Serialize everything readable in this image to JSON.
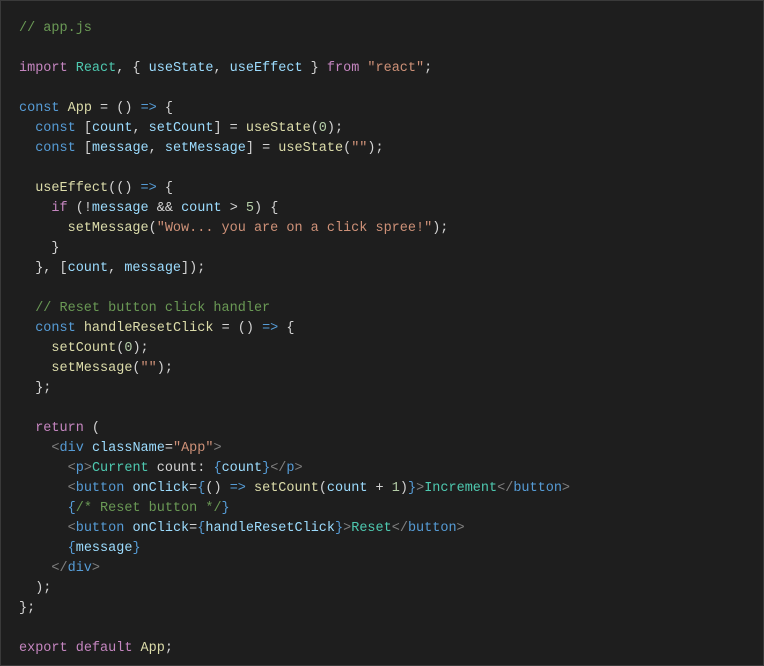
{
  "lines": {
    "l1_comment": "// app.js",
    "l2_import": "import",
    "l2_react": "React",
    "l2_usestate": "useState",
    "l2_useeffect": "useEffect",
    "l2_from": "from",
    "l2_reactstr": "\"react\"",
    "l3_const": "const",
    "l3_app": "App",
    "l4_const": "const",
    "l4_count": "count",
    "l4_setcount": "setCount",
    "l4_usestate": "useState",
    "l4_zero": "0",
    "l5_const": "const",
    "l5_message": "message",
    "l5_setmessage": "setMessage",
    "l5_usestate": "useState",
    "l5_empty": "\"\"",
    "l6_useeffect": "useEffect",
    "l7_if": "if",
    "l7_message": "message",
    "l7_count": "count",
    "l7_five": "5",
    "l8_setmessage": "setMessage",
    "l8_str": "\"Wow... you are on a click spree!\"",
    "l9_count": "count",
    "l9_message": "message",
    "l10_comment": "// Reset button click handler",
    "l11_const": "const",
    "l11_handle": "handleResetClick",
    "l12_setcount": "setCount",
    "l12_zero": "0",
    "l13_setmessage": "setMessage",
    "l13_empty": "\"\"",
    "l14_return": "return",
    "l15_div": "div",
    "l15_classname": "className",
    "l15_appstr": "\"App\"",
    "l16_p": "p",
    "l16_current": "Current",
    "l16_text": " count: ",
    "l16_count": "count",
    "l17_button": "button",
    "l17_onclick": "onClick",
    "l17_setcount": "setCount",
    "l17_count": "count",
    "l17_one": "1",
    "l17_increment": "Increment",
    "l18_comment": "/* Reset button */",
    "l19_button": "button",
    "l19_onclick": "onClick",
    "l19_handle": "handleResetClick",
    "l19_reset": "Reset",
    "l20_message": "message",
    "l21_div": "div",
    "l22_export": "export",
    "l22_default": "default",
    "l22_app": "App"
  }
}
